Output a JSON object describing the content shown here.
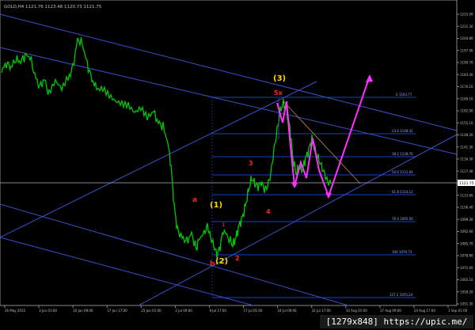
{
  "window": {
    "title": "GOLD,H4",
    "ohlc": "1121.76  1123.48  1120.73  1121.75"
  },
  "colors": {
    "background": "#000000",
    "price_line": "#00c800",
    "channel_line": "#3c50c8",
    "fib_line": "#1e5aff",
    "wave_label_gold": "#ffd700",
    "wave_label_red": "#ff2020",
    "projection": "#ff30ff",
    "axis_text": "#c0c0c0"
  },
  "price_axis": {
    "ticks": [
      "1215.00",
      "1211.30",
      "1204.80",
      "1197.90",
      "1190.70",
      "1183.40",
      "1176.10",
      "1169.10",
      "1162.00",
      "1155.10",
      "1148.20",
      "1141.30",
      "1134.30",
      "1127.40",
      "1120.50",
      "1113.60",
      "1106.40",
      "1099.30",
      "1092.60",
      "1085.70",
      "1078.80",
      "1072.00",
      "1065.10",
      "1058.20",
      "1051.30"
    ],
    "current_price": "1121.75"
  },
  "time_axis": {
    "ticks": [
      "26 May 2015",
      "3 Jun 01:00",
      "10 Jun 09:00",
      "17 Jun 17:00",
      "25 Jun 01:00",
      "2 Jul 09:00",
      "9 Jul 17:00",
      "17 Jul 01:00",
      "24 Jul 09:00",
      "31 Jul 17:00",
      "10 Aug 01:00",
      "17 Aug 09:00",
      "24 Aug 17:00",
      "1 Sep 01:00"
    ]
  },
  "fib_levels": [
    {
      "label": "0  1163.77"
    },
    {
      "label": "23.6  1148.32"
    },
    {
      "label": "38.2  1138.76"
    },
    {
      "label": "50.0  1131.04"
    },
    {
      "label": "61.8  1114.12"
    },
    {
      "label": "76.4  1095.00"
    },
    {
      "label": "100  1079.73"
    },
    {
      "label": "127.2  1055.24"
    }
  ],
  "wave_labels": [
    {
      "text": "(3)",
      "color": "gold"
    },
    {
      "text": "5x",
      "color": "red"
    },
    {
      "text": "3",
      "color": "red"
    },
    {
      "text": "a",
      "color": "red"
    },
    {
      "text": "(1)",
      "color": "gold"
    },
    {
      "text": "1",
      "color": "red"
    },
    {
      "text": "4",
      "color": "red"
    },
    {
      "text": "b",
      "color": "red"
    },
    {
      "text": "(2)",
      "color": "gold"
    },
    {
      "text": "2",
      "color": "red"
    }
  ],
  "watermark": "[1279x848] https://upic.me/"
}
